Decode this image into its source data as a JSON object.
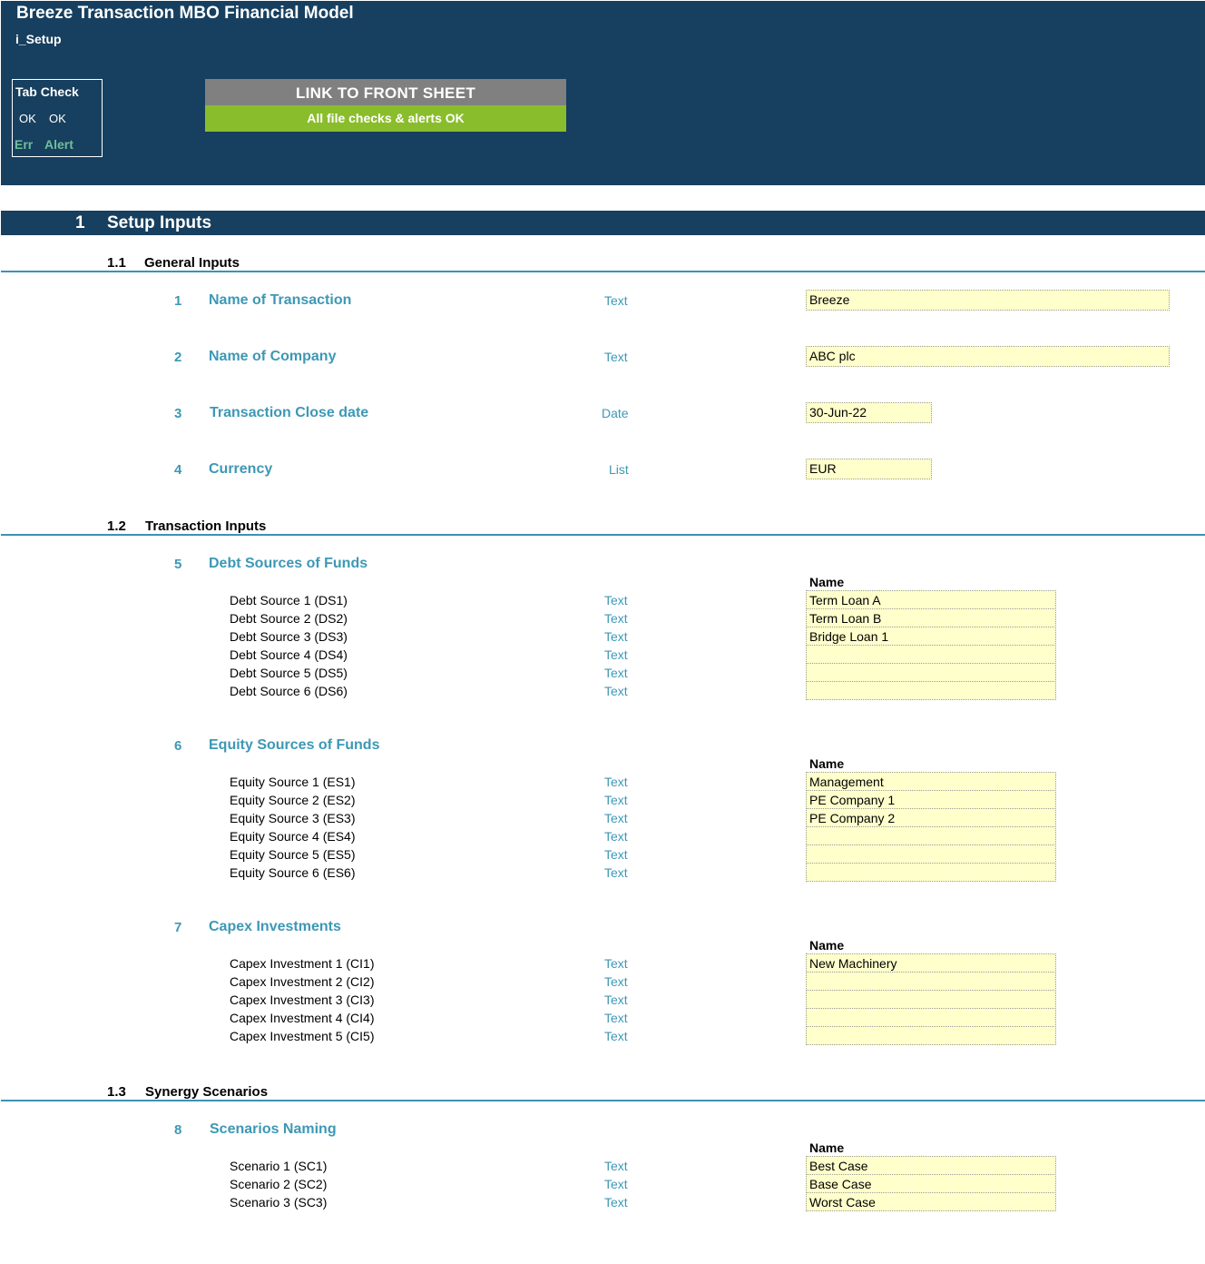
{
  "app": {
    "title": "Breeze Transaction MBO Financial Model",
    "sheet": "i_Setup"
  },
  "tab_check": {
    "title": "Tab Check",
    "ok1": "OK",
    "ok2": "OK",
    "err": "Err",
    "alert": "Alert"
  },
  "link_button": "LINK TO FRONT SHEET",
  "checks_status": "All file checks & alerts OK",
  "colors": {
    "header": "#173f5f",
    "accent": "#3d98b5",
    "status_ok": "#8abd2c",
    "input_fill": "#ffffcc",
    "link_button": "#808080",
    "err_alert": "#6fbf99"
  },
  "section": {
    "num": "1",
    "title": "Setup Inputs"
  },
  "general": {
    "num": "1.1",
    "title": "General Inputs",
    "items": [
      {
        "num": "1",
        "title": "Name of Transaction",
        "type": "Text",
        "value": "Breeze"
      },
      {
        "num": "2",
        "title": "Name of Company",
        "type": "Text",
        "value": "ABC plc"
      },
      {
        "num": "3",
        "title": "Transaction Close date",
        "type": "Date",
        "value": "30-Jun-22"
      },
      {
        "num": "4",
        "title": "Currency",
        "type": "List",
        "value": "EUR"
      }
    ]
  },
  "transaction": {
    "num": "1.2",
    "title": "Transaction Inputs",
    "debt": {
      "num": "5",
      "title": "Debt Sources of Funds",
      "name_header": "Name",
      "rows": [
        {
          "label": "Debt Source 1 (DS1)",
          "type": "Text",
          "value": "Term Loan A"
        },
        {
          "label": "Debt Source 2 (DS2)",
          "type": "Text",
          "value": "Term Loan B"
        },
        {
          "label": "Debt Source 3 (DS3)",
          "type": "Text",
          "value": "Bridge Loan 1"
        },
        {
          "label": "Debt Source 4 (DS4)",
          "type": "Text",
          "value": ""
        },
        {
          "label": "Debt Source 5 (DS5)",
          "type": "Text",
          "value": ""
        },
        {
          "label": "Debt Source 6 (DS6)",
          "type": "Text",
          "value": ""
        }
      ]
    },
    "equity": {
      "num": "6",
      "title": "Equity Sources of Funds",
      "name_header": "Name",
      "rows": [
        {
          "label": "Equity Source 1 (ES1)",
          "type": "Text",
          "value": "Management"
        },
        {
          "label": "Equity Source 2 (ES2)",
          "type": "Text",
          "value": "PE Company 1"
        },
        {
          "label": "Equity Source 3 (ES3)",
          "type": "Text",
          "value": "PE Company 2"
        },
        {
          "label": "Equity Source 4 (ES4)",
          "type": "Text",
          "value": ""
        },
        {
          "label": "Equity Source 5 (ES5)",
          "type": "Text",
          "value": ""
        },
        {
          "label": "Equity Source 6 (ES6)",
          "type": "Text",
          "value": ""
        }
      ]
    },
    "capex": {
      "num": "7",
      "title": "Capex Investments",
      "name_header": "Name",
      "rows": [
        {
          "label": "Capex Investment 1 (CI1)",
          "type": "Text",
          "value": "New Machinery"
        },
        {
          "label": "Capex Investment 2 (CI2)",
          "type": "Text",
          "value": ""
        },
        {
          "label": "Capex Investment 3 (CI3)",
          "type": "Text",
          "value": ""
        },
        {
          "label": "Capex Investment 4 (CI4)",
          "type": "Text",
          "value": ""
        },
        {
          "label": "Capex Investment 5 (CI5)",
          "type": "Text",
          "value": ""
        }
      ]
    }
  },
  "synergy": {
    "num": "1.3",
    "title": "Synergy Scenarios",
    "scenarios": {
      "num": "8",
      "title": "Scenarios Naming",
      "name_header": "Name",
      "rows": [
        {
          "label": "Scenario 1 (SC1)",
          "type": "Text",
          "value": "Best Case"
        },
        {
          "label": "Scenario 2 (SC2)",
          "type": "Text",
          "value": "Base Case"
        },
        {
          "label": "Scenario 3 (SC3)",
          "type": "Text",
          "value": "Worst Case"
        }
      ]
    }
  }
}
